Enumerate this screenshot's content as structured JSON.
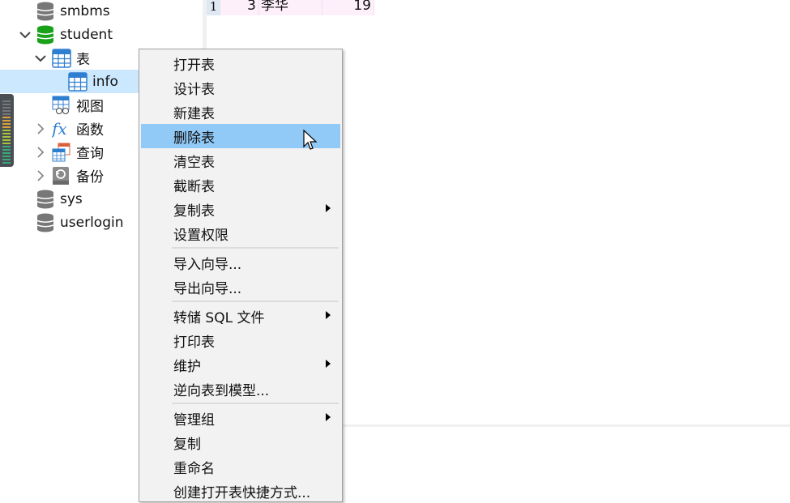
{
  "tree": [
    {
      "label": "smbms",
      "icon": "database-icon",
      "level": 1,
      "color": "#777777"
    },
    {
      "label": "student",
      "icon": "database-icon",
      "level": 1,
      "expanded": true,
      "color": "#1aa11a"
    },
    {
      "label": "表",
      "icon": "table-icon",
      "level": 2,
      "expanded": true
    },
    {
      "label": "info",
      "icon": "table-icon",
      "level": 3,
      "selected": true
    },
    {
      "label": "视图",
      "icon": "view-icon",
      "level": 2
    },
    {
      "label": "函数",
      "icon": "function-icon",
      "level": 2,
      "collapsed": true
    },
    {
      "label": "查询",
      "icon": "query-icon",
      "level": 2,
      "collapsed": true
    },
    {
      "label": "备份",
      "icon": "backup-icon",
      "level": 2,
      "collapsed": true
    },
    {
      "label": "sys",
      "icon": "database-icon",
      "level": 1,
      "color": "#777777"
    },
    {
      "label": "userlogin",
      "icon": "database-icon",
      "level": 1,
      "color": "#777777"
    }
  ],
  "grid": {
    "row_number": "1",
    "cells": [
      "3",
      "李华",
      "19"
    ]
  },
  "menu": [
    {
      "label": "打开表"
    },
    {
      "label": "设计表"
    },
    {
      "label": "新建表"
    },
    {
      "label": "删除表",
      "highlighted": true
    },
    {
      "label": "清空表"
    },
    {
      "label": "截断表"
    },
    {
      "label": "复制表",
      "submenu": true
    },
    {
      "label": "设置权限"
    },
    {
      "separator": true
    },
    {
      "label": "导入向导..."
    },
    {
      "label": "导出向导..."
    },
    {
      "separator": true
    },
    {
      "label": "转储 SQL 文件",
      "submenu": true
    },
    {
      "label": "打印表"
    },
    {
      "label": "维护",
      "submenu": true
    },
    {
      "label": "逆向表到模型..."
    },
    {
      "separator": true
    },
    {
      "label": "管理组",
      "submenu": true
    },
    {
      "label": "复制"
    },
    {
      "label": "重命名"
    },
    {
      "label": "创建打开表快捷方式..."
    }
  ],
  "colors": {
    "highlight": "#91c9f7",
    "selection": "#cce8ff",
    "table_icon": "#2f7fd1"
  }
}
